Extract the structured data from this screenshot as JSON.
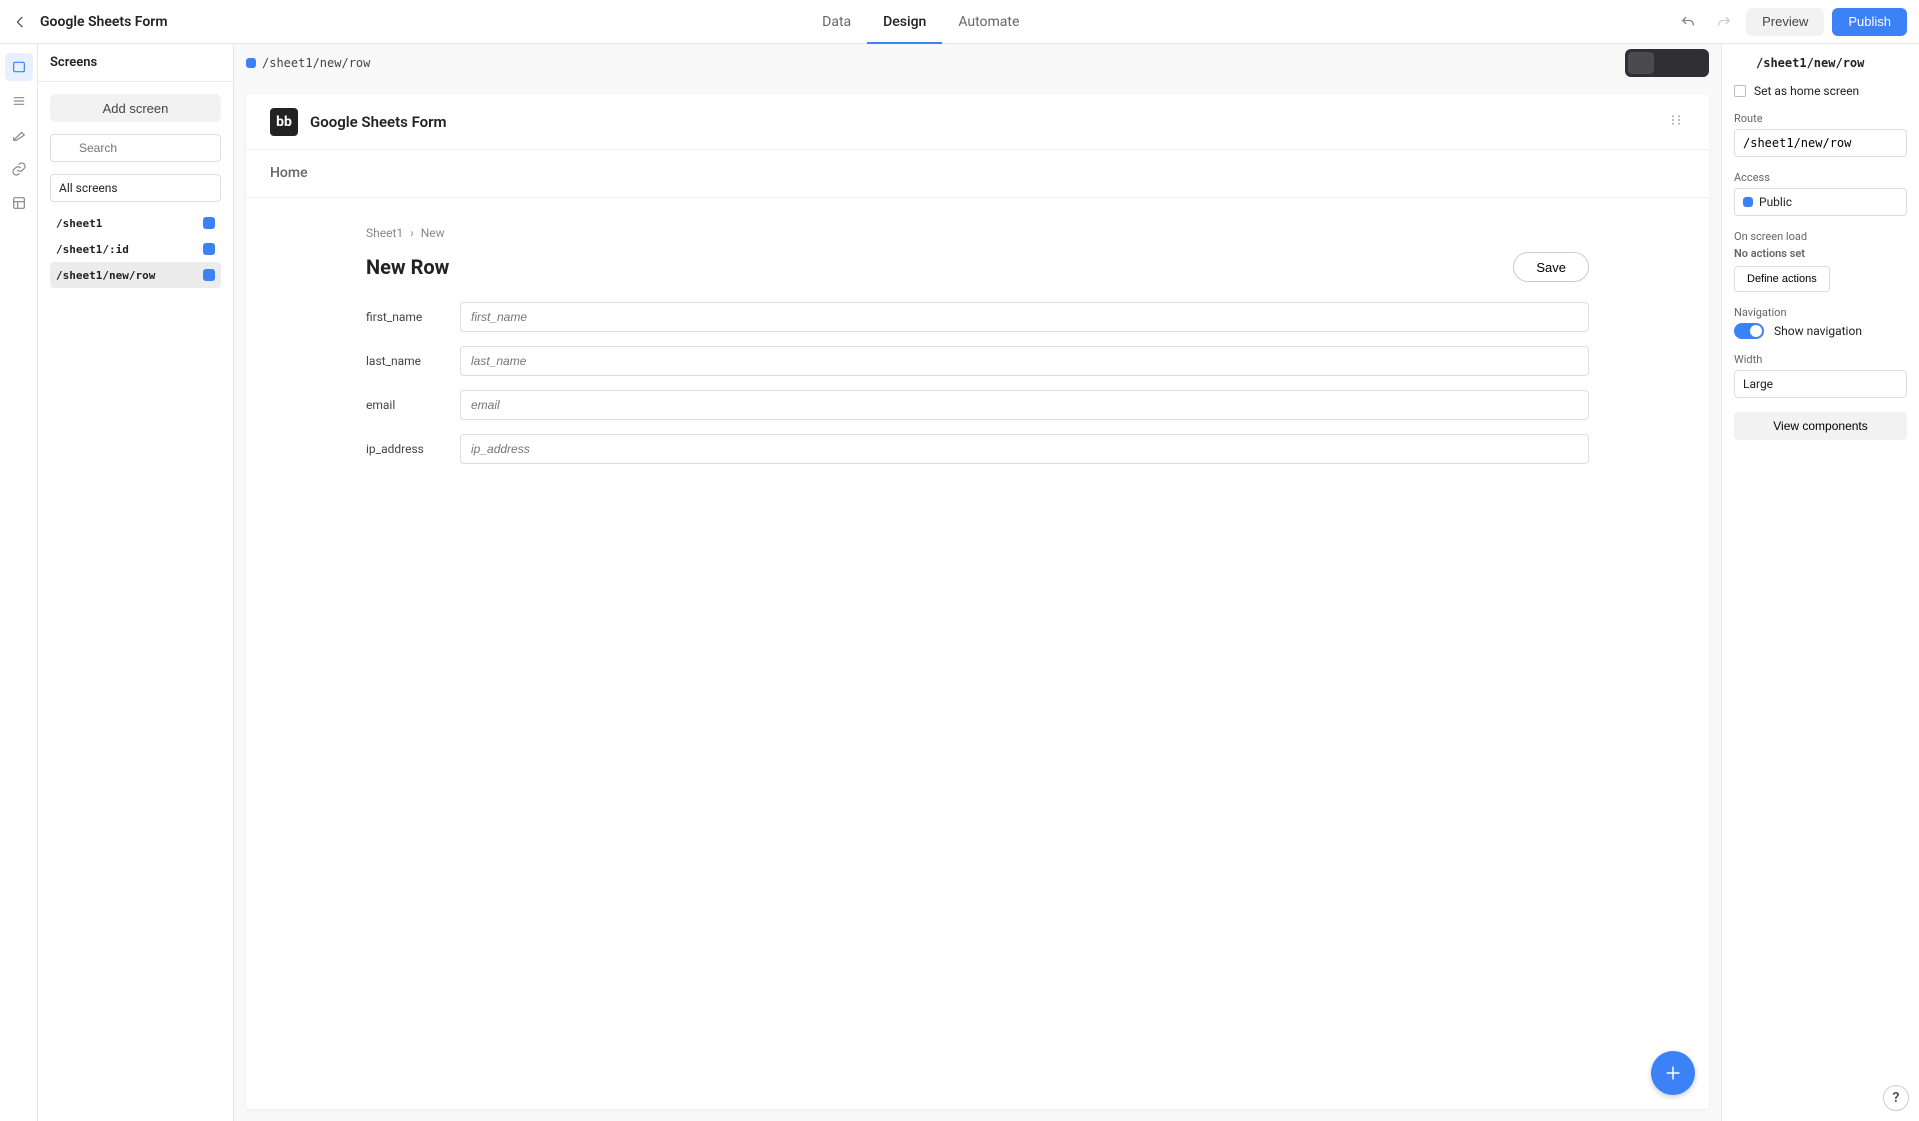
{
  "app_name": "Google Sheets Form",
  "top_tabs": {
    "data": "Data",
    "design": "Design",
    "automate": "Automate"
  },
  "top_buttons": {
    "preview": "Preview",
    "publish": "Publish"
  },
  "left_panel": {
    "title": "Screens",
    "add_screen": "Add screen",
    "search_placeholder": "Search",
    "filter": "All screens",
    "items": [
      {
        "path": "/sheet1"
      },
      {
        "path": "/sheet1/:id"
      },
      {
        "path": "/sheet1/new/row"
      }
    ]
  },
  "canvas": {
    "route": "/sheet1/new/row",
    "frame_title": "Google Sheets Form",
    "nav_home": "Home",
    "breadcrumb_link": "Sheet1",
    "breadcrumb_current": "New",
    "form_title": "New Row",
    "save_label": "Save",
    "fields": [
      {
        "label": "first_name",
        "placeholder": "first_name"
      },
      {
        "label": "last_name",
        "placeholder": "last_name"
      },
      {
        "label": "email",
        "placeholder": "email"
      },
      {
        "label": "ip_address",
        "placeholder": "ip_address"
      }
    ]
  },
  "right_panel": {
    "header": "/sheet1/new/row",
    "set_home": "Set as home screen",
    "route_label": "Route",
    "route_value": "/sheet1/new/row",
    "access_label": "Access",
    "access_value": "Public",
    "onload_label": "On screen load",
    "onload_status": "No actions set",
    "define_actions": "Define actions",
    "navigation_label": "Navigation",
    "show_navigation": "Show navigation",
    "width_label": "Width",
    "width_value": "Large",
    "view_components": "View components"
  },
  "colors": {
    "accent": "#3b82f6"
  }
}
